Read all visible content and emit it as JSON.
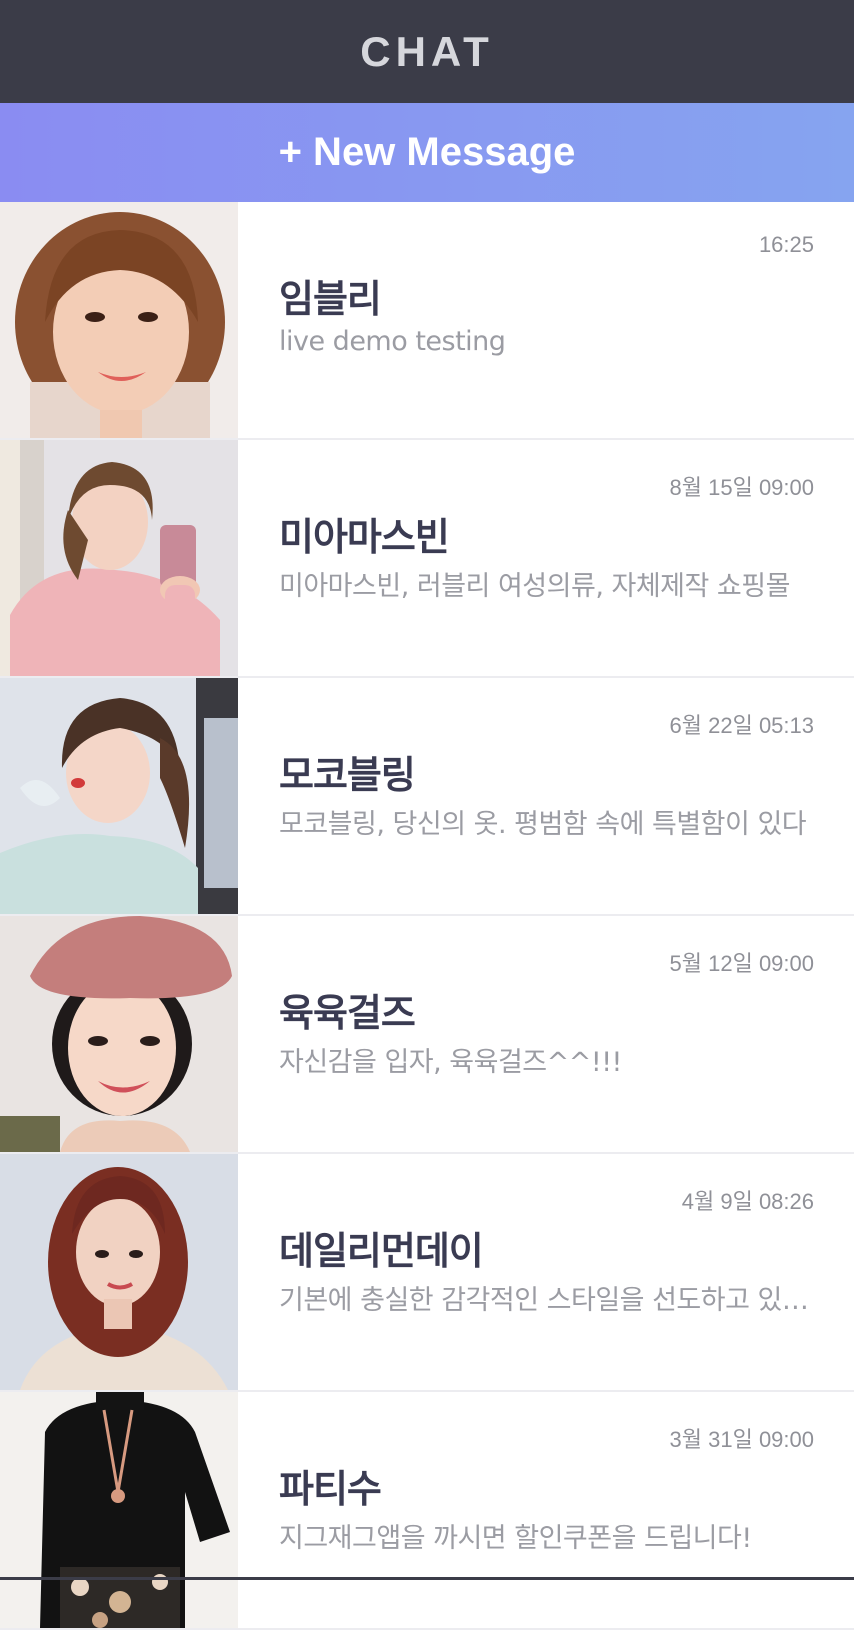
{
  "header": {
    "title": "CHAT"
  },
  "new_message": {
    "label": "+ New Message"
  },
  "colors": {
    "header_bg": "#3b3c48",
    "gradient_start": "#8a8cf2",
    "gradient_end": "#86a4f0",
    "name_text": "#3a3b52",
    "preview_text": "#9b9ca3"
  },
  "chats": [
    {
      "name": "임블리",
      "preview": "live demo testing",
      "time": "16:25",
      "avatar": "avatar-woman-short-brown-hair"
    },
    {
      "name": "미아마스빈",
      "preview": "미아마스빈, 러블리 여성의류, 자체제작 쇼핑몰",
      "time": "8월 15일 09:00",
      "avatar": "avatar-woman-pink-sweater-mirror"
    },
    {
      "name": "모코블링",
      "preview": "모코블링, 당신의 옷. 평범함 속에 특별함이 있다",
      "time": "6월 22일 05:13",
      "avatar": "avatar-woman-mint-sweater"
    },
    {
      "name": "육육걸즈",
      "preview": "자신감을 입자, 육육걸즈^^!!!",
      "time": "5월 12일 09:00",
      "avatar": "avatar-woman-beret"
    },
    {
      "name": "데일리먼데이",
      "preview": "기본에 충실한 감각적인 스타일을 선도하고 있습니다",
      "time": "4월 9일 08:26",
      "avatar": "avatar-woman-red-hair"
    },
    {
      "name": "파티수",
      "preview": "지그재그앱을 까시면 할인쿠폰을 드립니다!",
      "time": "3월 31일 09:00",
      "avatar": "avatar-woman-black-top"
    }
  ]
}
